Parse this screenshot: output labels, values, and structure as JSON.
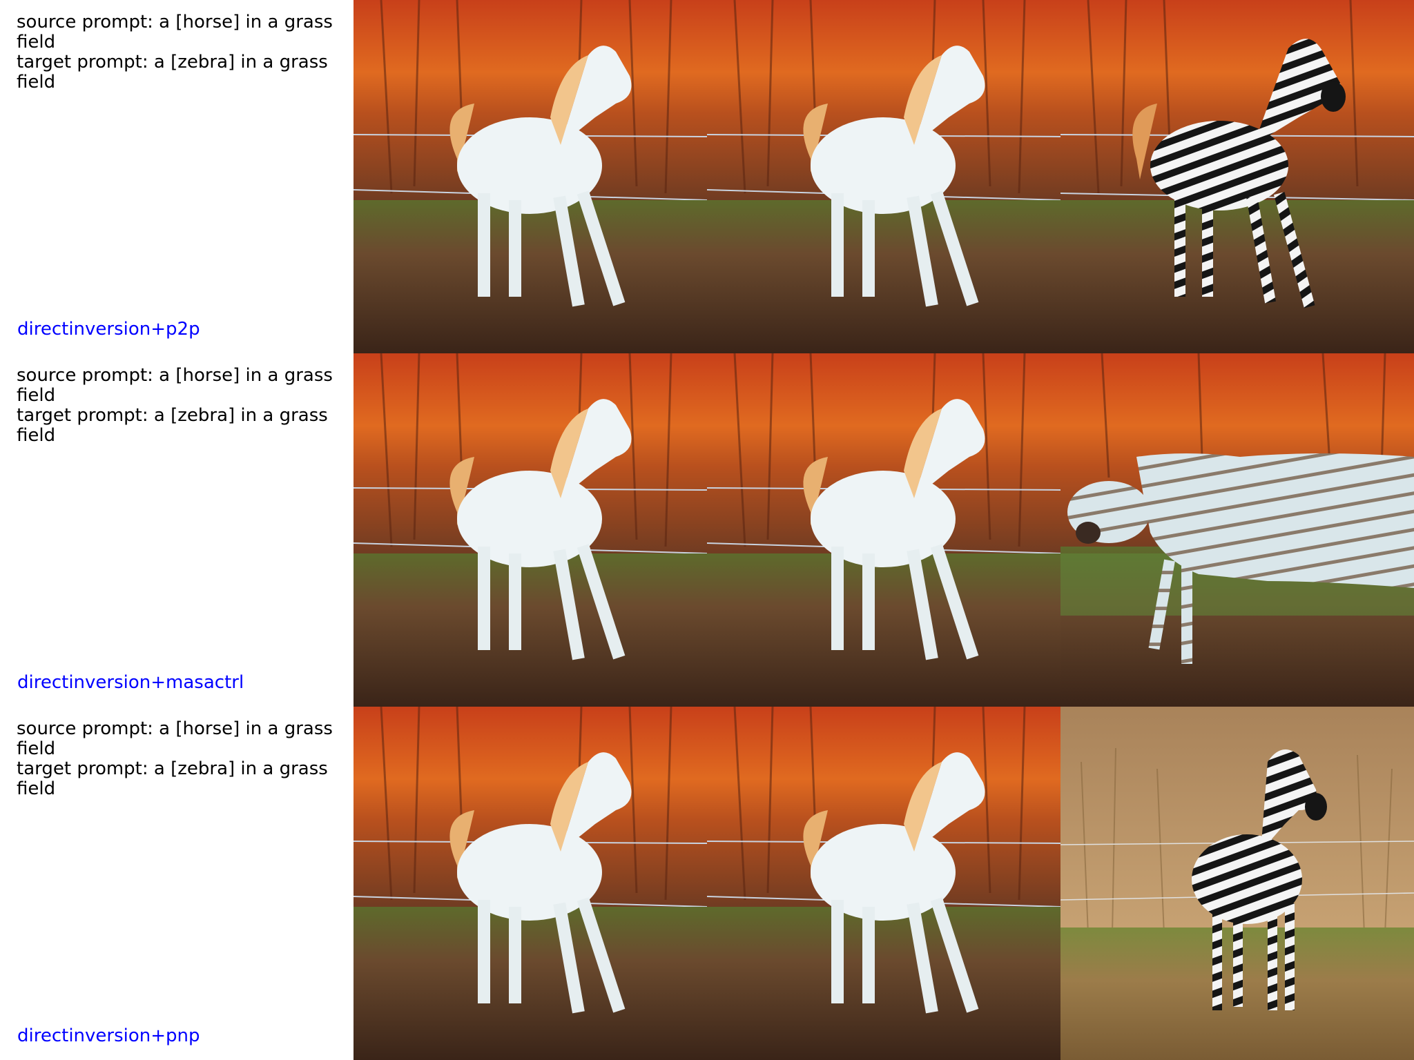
{
  "rows": [
    {
      "source_prompt": "source prompt: a [horse] in a grass field",
      "target_prompt": "target prompt: a [zebra] in a grass field",
      "method": "directinversion+p2p",
      "images": [
        "source-horse-photo",
        "reconstructed-horse-photo",
        "edited-zebra-photo"
      ]
    },
    {
      "source_prompt": "source prompt: a [horse] in a grass field",
      "target_prompt": "target prompt: a [zebra] in a grass field",
      "method": "directinversion+masactrl",
      "images": [
        "source-horse-photo",
        "reconstructed-horse-photo",
        "edited-zebra-photo"
      ]
    },
    {
      "source_prompt": "source prompt: a [horse] in a grass field",
      "target_prompt": "target prompt: a [zebra] in a grass field",
      "method": "directinversion+pnp",
      "images": [
        "source-horse-photo",
        "reconstructed-horse-photo",
        "edited-zebra-photo"
      ]
    }
  ],
  "colors": {
    "method_label": "#0000ff",
    "prompt_text": "#000000",
    "sunset_sky": "#d2541a",
    "dry_field": "#b08a52"
  }
}
